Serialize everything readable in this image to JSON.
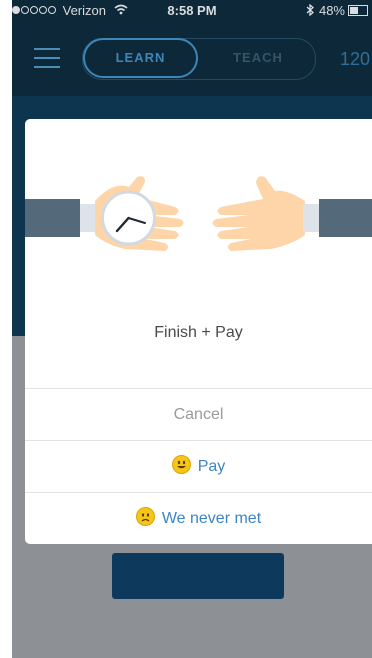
{
  "statusbar": {
    "carrier": "Verizon",
    "time": "8:58 PM",
    "battery": "48%",
    "battery_level": 0.48,
    "signal_bars_filled": 1,
    "signal_bars_total": 5
  },
  "header": {
    "tabs": [
      {
        "label": "LEARN",
        "selected": true
      },
      {
        "label": "TEACH",
        "selected": false
      }
    ],
    "credits": "120"
  },
  "modal": {
    "title": "Finish + Pay",
    "actions": [
      {
        "label": "Cancel",
        "icon": null
      },
      {
        "label": "Pay",
        "icon": "grinning-face-icon"
      },
      {
        "label": "We never met",
        "icon": "frowning-face-icon"
      }
    ]
  },
  "colors": {
    "accent": "#3d85c4",
    "overlay_top": "#0d2838",
    "sleeve": "#546a7b",
    "skin": "#fdd5a8"
  }
}
